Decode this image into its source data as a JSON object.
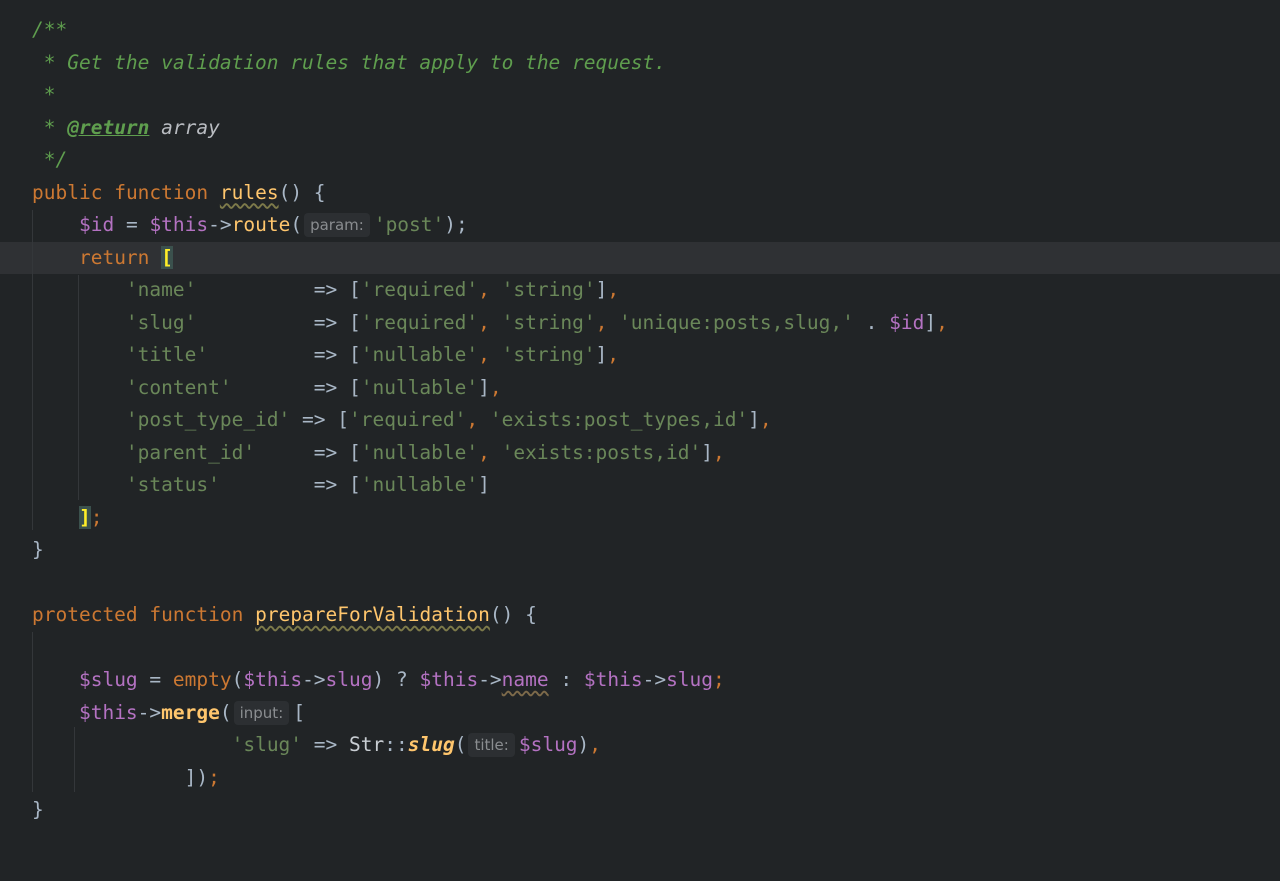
{
  "editor": {
    "lines": [
      [
        {
          "t": "/**",
          "c": "comment"
        }
      ],
      [
        {
          "t": " * Get the validation rules that apply to the request.",
          "c": "comment"
        }
      ],
      [
        {
          "t": " *",
          "c": "comment"
        }
      ],
      [
        {
          "t": " * ",
          "c": "comment"
        },
        {
          "t": "@return",
          "c": "doctag"
        },
        {
          "t": " array",
          "c": "doctype"
        }
      ],
      [
        {
          "t": " */",
          "c": "comment"
        }
      ],
      [
        {
          "t": "public",
          "c": "keyword"
        },
        {
          "t": " ",
          "c": "plain"
        },
        {
          "t": "function",
          "c": "keyword"
        },
        {
          "t": " ",
          "c": "plain"
        },
        {
          "t": "rules",
          "c": "fn-u"
        },
        {
          "t": "() {",
          "c": "plain"
        }
      ],
      [
        {
          "t": "    ",
          "c": "plain"
        },
        {
          "t": "$id",
          "c": "var"
        },
        {
          "t": " = ",
          "c": "plain"
        },
        {
          "t": "$this",
          "c": "var"
        },
        {
          "t": "->",
          "c": "plain"
        },
        {
          "t": "route",
          "c": "fn"
        },
        {
          "t": "(",
          "c": "plain"
        },
        {
          "t": "param:",
          "c": "hint"
        },
        {
          "t": "'post'",
          "c": "string"
        },
        {
          "t": ");",
          "c": "plain"
        }
      ],
      [
        {
          "t": "    ",
          "c": "plain"
        },
        {
          "t": "return",
          "c": "keyword"
        },
        {
          "t": " ",
          "c": "plain"
        },
        {
          "t": "[",
          "c": "bracket-match"
        }
      ],
      [
        {
          "t": "        ",
          "c": "plain"
        },
        {
          "t": "'name'",
          "c": "string"
        },
        {
          "t": "          => [",
          "c": "plain"
        },
        {
          "t": "'required'",
          "c": "string"
        },
        {
          "t": ", ",
          "c": "semi"
        },
        {
          "t": "'string'",
          "c": "string"
        },
        {
          "t": "]",
          "c": "plain"
        },
        {
          "t": ",",
          "c": "semi"
        }
      ],
      [
        {
          "t": "        ",
          "c": "plain"
        },
        {
          "t": "'slug'",
          "c": "string"
        },
        {
          "t": "          => [",
          "c": "plain"
        },
        {
          "t": "'required'",
          "c": "string"
        },
        {
          "t": ", ",
          "c": "semi"
        },
        {
          "t": "'string'",
          "c": "string"
        },
        {
          "t": ", ",
          "c": "semi"
        },
        {
          "t": "'unique:posts,slug,'",
          "c": "string"
        },
        {
          "t": " . ",
          "c": "plain"
        },
        {
          "t": "$id",
          "c": "var"
        },
        {
          "t": "]",
          "c": "plain"
        },
        {
          "t": ",",
          "c": "semi"
        }
      ],
      [
        {
          "t": "        ",
          "c": "plain"
        },
        {
          "t": "'title'",
          "c": "string"
        },
        {
          "t": "         => [",
          "c": "plain"
        },
        {
          "t": "'nullable'",
          "c": "string"
        },
        {
          "t": ", ",
          "c": "semi"
        },
        {
          "t": "'string'",
          "c": "string"
        },
        {
          "t": "]",
          "c": "plain"
        },
        {
          "t": ",",
          "c": "semi"
        }
      ],
      [
        {
          "t": "        ",
          "c": "plain"
        },
        {
          "t": "'content'",
          "c": "string"
        },
        {
          "t": "       => [",
          "c": "plain"
        },
        {
          "t": "'nullable'",
          "c": "string"
        },
        {
          "t": "]",
          "c": "plain"
        },
        {
          "t": ",",
          "c": "semi"
        }
      ],
      [
        {
          "t": "        ",
          "c": "plain"
        },
        {
          "t": "'post_type_id'",
          "c": "string"
        },
        {
          "t": " => [",
          "c": "plain"
        },
        {
          "t": "'required'",
          "c": "string"
        },
        {
          "t": ", ",
          "c": "semi"
        },
        {
          "t": "'exists:post_types,id'",
          "c": "string"
        },
        {
          "t": "]",
          "c": "plain"
        },
        {
          "t": ",",
          "c": "semi"
        }
      ],
      [
        {
          "t": "        ",
          "c": "plain"
        },
        {
          "t": "'parent_id'",
          "c": "string"
        },
        {
          "t": "     => [",
          "c": "plain"
        },
        {
          "t": "'nullable'",
          "c": "string"
        },
        {
          "t": ", ",
          "c": "semi"
        },
        {
          "t": "'exists:posts,id'",
          "c": "string"
        },
        {
          "t": "]",
          "c": "plain"
        },
        {
          "t": ",",
          "c": "semi"
        }
      ],
      [
        {
          "t": "        ",
          "c": "plain"
        },
        {
          "t": "'status'",
          "c": "string"
        },
        {
          "t": "        => [",
          "c": "plain"
        },
        {
          "t": "'nullable'",
          "c": "string"
        },
        {
          "t": "]",
          "c": "plain"
        }
      ],
      [
        {
          "t": "    ",
          "c": "plain"
        },
        {
          "t": "]",
          "c": "bracket-match"
        },
        {
          "t": ";",
          "c": "semi"
        }
      ],
      [
        {
          "t": "}",
          "c": "plain"
        }
      ],
      [],
      [
        {
          "t": "protected",
          "c": "keyword"
        },
        {
          "t": " ",
          "c": "plain"
        },
        {
          "t": "function",
          "c": "keyword"
        },
        {
          "t": " ",
          "c": "plain"
        },
        {
          "t": "prepareForValidation",
          "c": "fn-u"
        },
        {
          "t": "() {",
          "c": "plain"
        }
      ],
      [],
      [
        {
          "t": "    ",
          "c": "plain"
        },
        {
          "t": "$slug",
          "c": "var"
        },
        {
          "t": " = ",
          "c": "plain"
        },
        {
          "t": "empty",
          "c": "builtin"
        },
        {
          "t": "(",
          "c": "plain"
        },
        {
          "t": "$this",
          "c": "var"
        },
        {
          "t": "->",
          "c": "plain"
        },
        {
          "t": "slug",
          "c": "prop"
        },
        {
          "t": ") ? ",
          "c": "plain"
        },
        {
          "t": "$this",
          "c": "var"
        },
        {
          "t": "->",
          "c": "plain"
        },
        {
          "t": "name",
          "c": "prop-u"
        },
        {
          "t": " : ",
          "c": "plain"
        },
        {
          "t": "$this",
          "c": "var"
        },
        {
          "t": "->",
          "c": "plain"
        },
        {
          "t": "slug",
          "c": "prop"
        },
        {
          "t": ";",
          "c": "semi"
        }
      ],
      [
        {
          "t": "    ",
          "c": "plain"
        },
        {
          "t": "$this",
          "c": "var"
        },
        {
          "t": "->",
          "c": "plain"
        },
        {
          "t": "merge",
          "c": "fn-bold"
        },
        {
          "t": "(",
          "c": "plain"
        },
        {
          "t": "input:",
          "c": "hint"
        },
        {
          "t": "[",
          "c": "plain"
        }
      ],
      [
        {
          "t": "                 ",
          "c": "plain"
        },
        {
          "t": "'slug'",
          "c": "string"
        },
        {
          "t": " => ",
          "c": "plain"
        },
        {
          "t": "Str",
          "c": "class"
        },
        {
          "t": "::",
          "c": "plain"
        },
        {
          "t": "slug",
          "c": "fn-static"
        },
        {
          "t": "(",
          "c": "plain"
        },
        {
          "t": "title:",
          "c": "hint"
        },
        {
          "t": "$slug",
          "c": "var"
        },
        {
          "t": ")",
          "c": "plain"
        },
        {
          "t": ",",
          "c": "semi"
        }
      ],
      [
        {
          "t": "             ",
          "c": "plain"
        },
        {
          "t": "])",
          "c": "plain"
        },
        {
          "t": ";",
          "c": "semi"
        }
      ],
      [
        {
          "t": "}",
          "c": "plain"
        }
      ]
    ]
  }
}
